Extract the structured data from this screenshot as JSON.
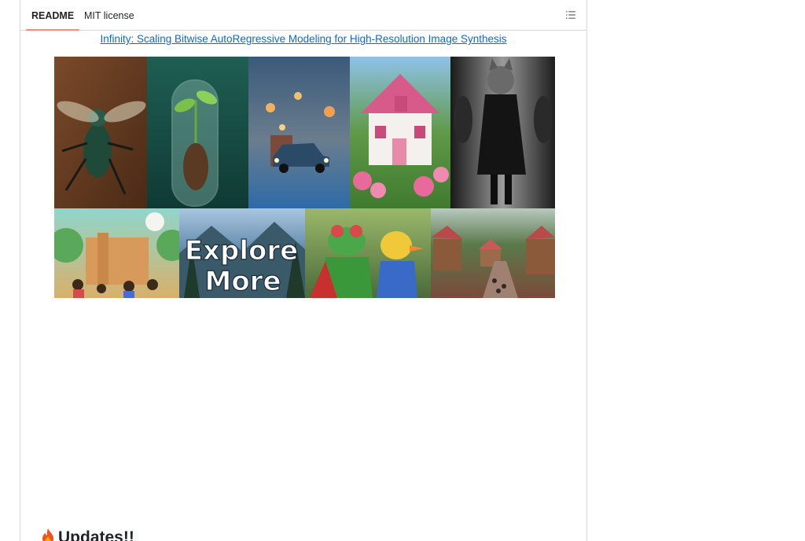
{
  "tabs": [
    {
      "label": "README",
      "active": true
    },
    {
      "label": "MIT license",
      "active": false
    }
  ],
  "toc_icon": "list-unordered-icon",
  "readme": {
    "title_link": "Infinity: Scaling Bitwise AutoRegressive Modeling for High-Resolution Image Synthesis",
    "mosaic": {
      "tiles": [
        {
          "subject": "insect-on-wood"
        },
        {
          "subject": "seedling-in-test-tube"
        },
        {
          "subject": "toy-car-on-street"
        },
        {
          "subject": "pink-roof-cottage"
        },
        {
          "subject": "cat-in-black-coat"
        },
        {
          "subject": "cartoon-school-children"
        },
        {
          "subject": "explore-more-sign",
          "text_line1": "Explore",
          "text_line2": "More"
        },
        {
          "subject": "frog-and-duck-toys"
        },
        {
          "subject": "village-street"
        }
      ]
    },
    "updates_heading": "Updates!!",
    "updates_icon": "fire-icon"
  },
  "colors": {
    "link": "#0969da",
    "tab_underline": "#fd8c73",
    "border": "#d0d7de"
  }
}
